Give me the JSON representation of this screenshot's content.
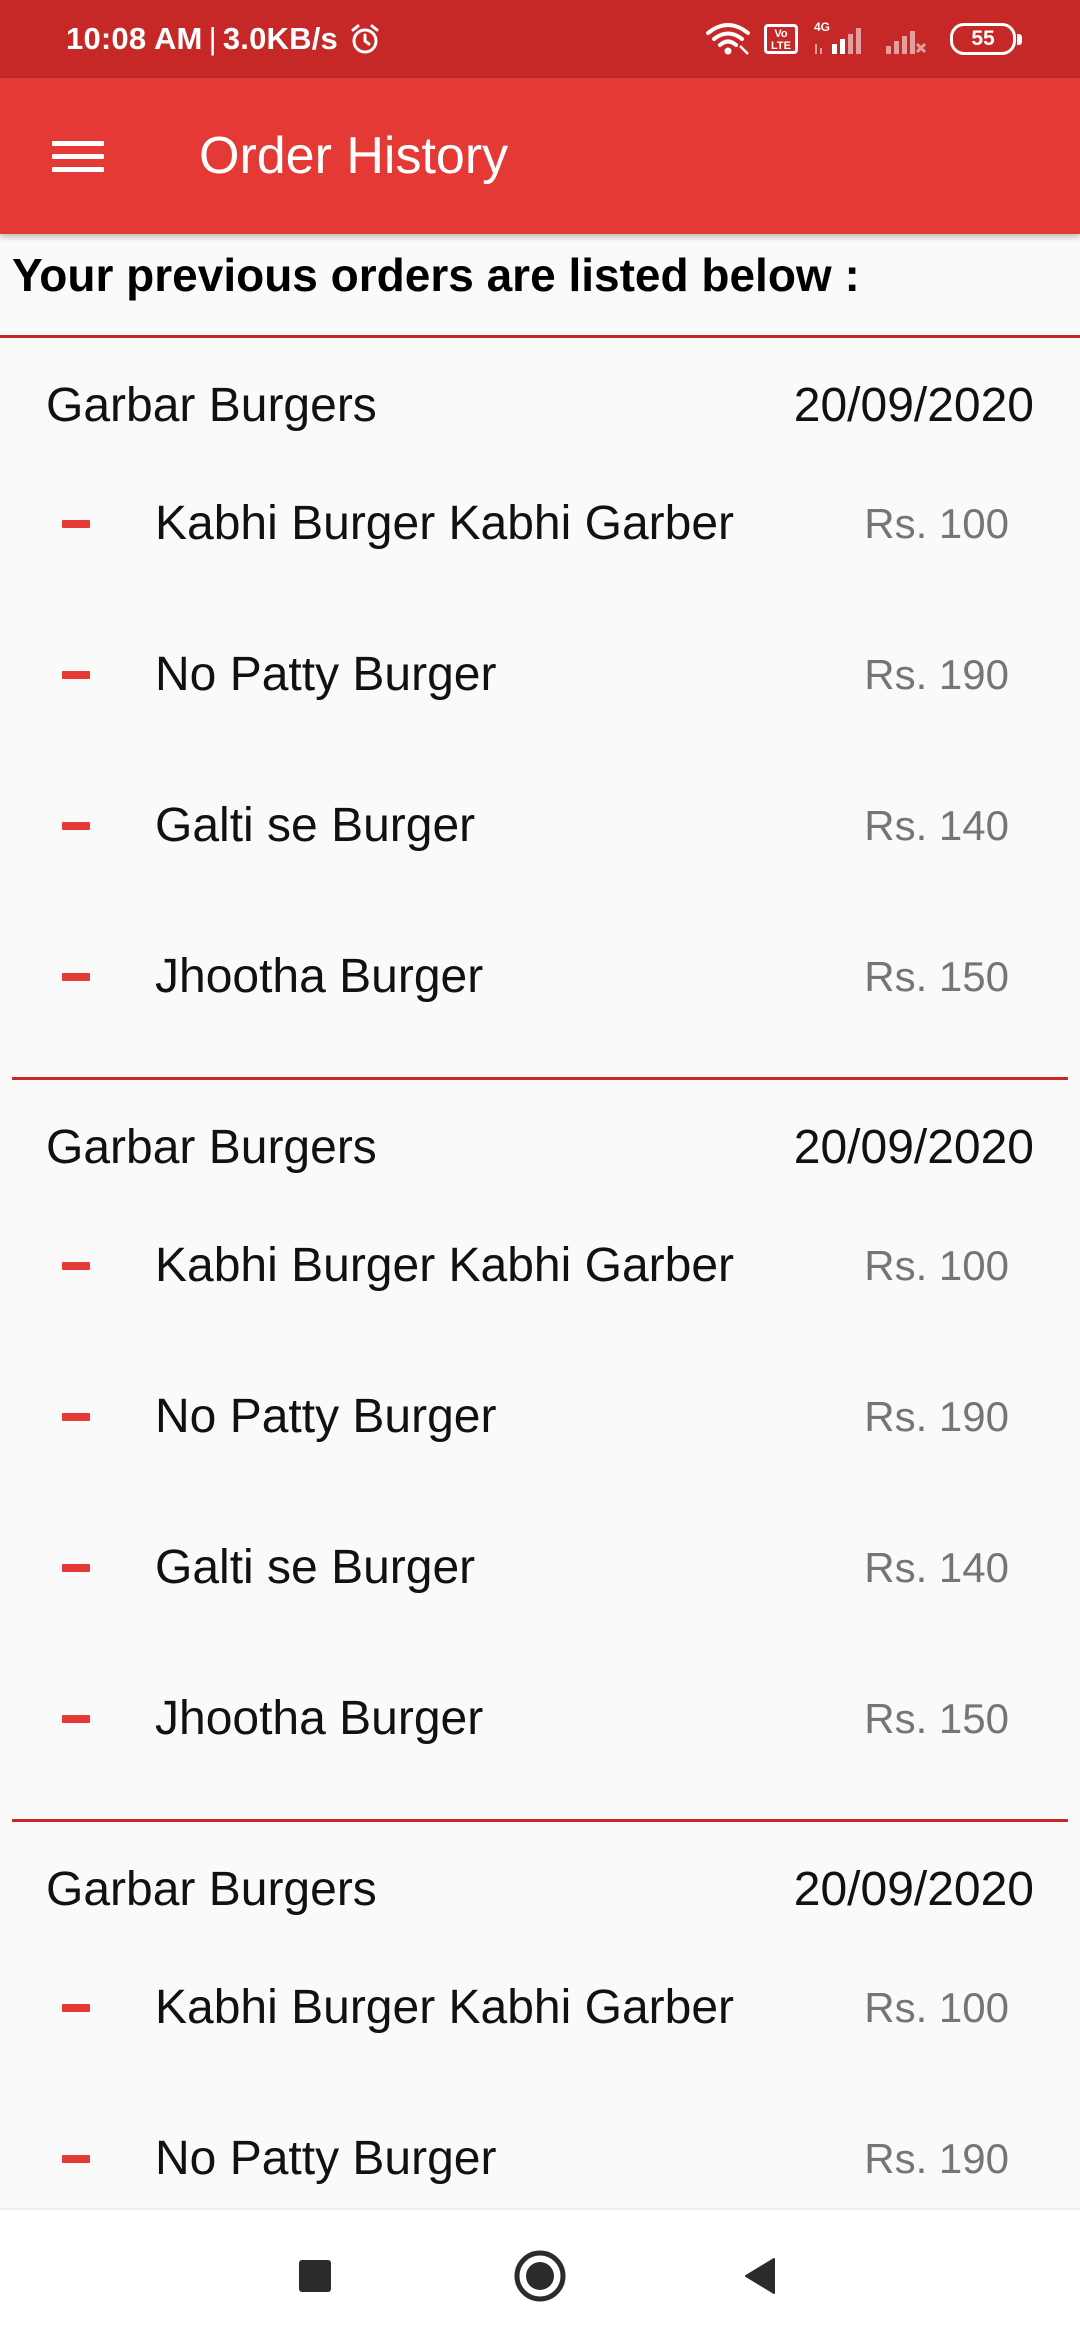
{
  "status_bar": {
    "time": "10:08 AM",
    "separator": "|",
    "speed": "3.0KB/s",
    "volte_top": "Vo",
    "volte_bottom": "LTE",
    "network": "4G",
    "battery": "55",
    "icons": [
      "alarm-icon",
      "wifi-icon",
      "volte-icon",
      "signal-icon",
      "signal-weak-icon",
      "battery-icon"
    ],
    "color": "#c62828"
  },
  "app_bar": {
    "title": "Order History",
    "menu_icon": "hamburger-menu-icon",
    "color": "#e53935"
  },
  "subheader": "Your previous orders are listed below :",
  "orders": [
    {
      "restaurant": "Garbar Burgers",
      "date": "20/09/2020",
      "items": [
        {
          "name": "Kabhi Burger Kabhi Garber",
          "price": "Rs. 100"
        },
        {
          "name": "No Patty Burger",
          "price": "Rs. 190"
        },
        {
          "name": "Galti se Burger",
          "price": "Rs. 140"
        },
        {
          "name": "Jhootha Burger",
          "price": "Rs. 150"
        }
      ]
    },
    {
      "restaurant": "Garbar Burgers",
      "date": "20/09/2020",
      "items": [
        {
          "name": "Kabhi Burger Kabhi Garber",
          "price": "Rs. 100"
        },
        {
          "name": "No Patty Burger",
          "price": "Rs. 190"
        },
        {
          "name": "Galti se Burger",
          "price": "Rs. 140"
        },
        {
          "name": "Jhootha Burger",
          "price": "Rs. 150"
        }
      ]
    },
    {
      "restaurant": "Garbar Burgers",
      "date": "20/09/2020",
      "items": [
        {
          "name": "Kabhi Burger Kabhi Garber",
          "price": "Rs. 100"
        },
        {
          "name": "No Patty Burger",
          "price": "Rs. 190"
        }
      ]
    }
  ],
  "nav_bar": {
    "icons": [
      "recents-square-icon",
      "home-circle-icon",
      "back-triangle-icon"
    ]
  }
}
